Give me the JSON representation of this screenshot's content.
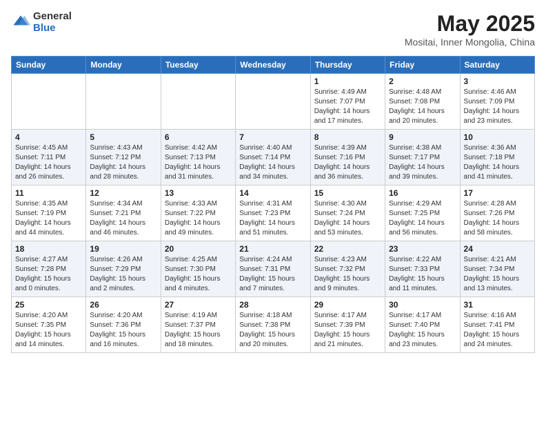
{
  "header": {
    "logo_general": "General",
    "logo_blue": "Blue",
    "month_title": "May 2025",
    "location": "Mositai, Inner Mongolia, China"
  },
  "days_of_week": [
    "Sunday",
    "Monday",
    "Tuesday",
    "Wednesday",
    "Thursday",
    "Friday",
    "Saturday"
  ],
  "weeks": [
    [
      {
        "day": "",
        "info": ""
      },
      {
        "day": "",
        "info": ""
      },
      {
        "day": "",
        "info": ""
      },
      {
        "day": "",
        "info": ""
      },
      {
        "day": "1",
        "info": "Sunrise: 4:49 AM\nSunset: 7:07 PM\nDaylight: 14 hours\nand 17 minutes."
      },
      {
        "day": "2",
        "info": "Sunrise: 4:48 AM\nSunset: 7:08 PM\nDaylight: 14 hours\nand 20 minutes."
      },
      {
        "day": "3",
        "info": "Sunrise: 4:46 AM\nSunset: 7:09 PM\nDaylight: 14 hours\nand 23 minutes."
      }
    ],
    [
      {
        "day": "4",
        "info": "Sunrise: 4:45 AM\nSunset: 7:11 PM\nDaylight: 14 hours\nand 26 minutes."
      },
      {
        "day": "5",
        "info": "Sunrise: 4:43 AM\nSunset: 7:12 PM\nDaylight: 14 hours\nand 28 minutes."
      },
      {
        "day": "6",
        "info": "Sunrise: 4:42 AM\nSunset: 7:13 PM\nDaylight: 14 hours\nand 31 minutes."
      },
      {
        "day": "7",
        "info": "Sunrise: 4:40 AM\nSunset: 7:14 PM\nDaylight: 14 hours\nand 34 minutes."
      },
      {
        "day": "8",
        "info": "Sunrise: 4:39 AM\nSunset: 7:16 PM\nDaylight: 14 hours\nand 36 minutes."
      },
      {
        "day": "9",
        "info": "Sunrise: 4:38 AM\nSunset: 7:17 PM\nDaylight: 14 hours\nand 39 minutes."
      },
      {
        "day": "10",
        "info": "Sunrise: 4:36 AM\nSunset: 7:18 PM\nDaylight: 14 hours\nand 41 minutes."
      }
    ],
    [
      {
        "day": "11",
        "info": "Sunrise: 4:35 AM\nSunset: 7:19 PM\nDaylight: 14 hours\nand 44 minutes."
      },
      {
        "day": "12",
        "info": "Sunrise: 4:34 AM\nSunset: 7:21 PM\nDaylight: 14 hours\nand 46 minutes."
      },
      {
        "day": "13",
        "info": "Sunrise: 4:33 AM\nSunset: 7:22 PM\nDaylight: 14 hours\nand 49 minutes."
      },
      {
        "day": "14",
        "info": "Sunrise: 4:31 AM\nSunset: 7:23 PM\nDaylight: 14 hours\nand 51 minutes."
      },
      {
        "day": "15",
        "info": "Sunrise: 4:30 AM\nSunset: 7:24 PM\nDaylight: 14 hours\nand 53 minutes."
      },
      {
        "day": "16",
        "info": "Sunrise: 4:29 AM\nSunset: 7:25 PM\nDaylight: 14 hours\nand 56 minutes."
      },
      {
        "day": "17",
        "info": "Sunrise: 4:28 AM\nSunset: 7:26 PM\nDaylight: 14 hours\nand 58 minutes."
      }
    ],
    [
      {
        "day": "18",
        "info": "Sunrise: 4:27 AM\nSunset: 7:28 PM\nDaylight: 15 hours\nand 0 minutes."
      },
      {
        "day": "19",
        "info": "Sunrise: 4:26 AM\nSunset: 7:29 PM\nDaylight: 15 hours\nand 2 minutes."
      },
      {
        "day": "20",
        "info": "Sunrise: 4:25 AM\nSunset: 7:30 PM\nDaylight: 15 hours\nand 4 minutes."
      },
      {
        "day": "21",
        "info": "Sunrise: 4:24 AM\nSunset: 7:31 PM\nDaylight: 15 hours\nand 7 minutes."
      },
      {
        "day": "22",
        "info": "Sunrise: 4:23 AM\nSunset: 7:32 PM\nDaylight: 15 hours\nand 9 minutes."
      },
      {
        "day": "23",
        "info": "Sunrise: 4:22 AM\nSunset: 7:33 PM\nDaylight: 15 hours\nand 11 minutes."
      },
      {
        "day": "24",
        "info": "Sunrise: 4:21 AM\nSunset: 7:34 PM\nDaylight: 15 hours\nand 13 minutes."
      }
    ],
    [
      {
        "day": "25",
        "info": "Sunrise: 4:20 AM\nSunset: 7:35 PM\nDaylight: 15 hours\nand 14 minutes."
      },
      {
        "day": "26",
        "info": "Sunrise: 4:20 AM\nSunset: 7:36 PM\nDaylight: 15 hours\nand 16 minutes."
      },
      {
        "day": "27",
        "info": "Sunrise: 4:19 AM\nSunset: 7:37 PM\nDaylight: 15 hours\nand 18 minutes."
      },
      {
        "day": "28",
        "info": "Sunrise: 4:18 AM\nSunset: 7:38 PM\nDaylight: 15 hours\nand 20 minutes."
      },
      {
        "day": "29",
        "info": "Sunrise: 4:17 AM\nSunset: 7:39 PM\nDaylight: 15 hours\nand 21 minutes."
      },
      {
        "day": "30",
        "info": "Sunrise: 4:17 AM\nSunset: 7:40 PM\nDaylight: 15 hours\nand 23 minutes."
      },
      {
        "day": "31",
        "info": "Sunrise: 4:16 AM\nSunset: 7:41 PM\nDaylight: 15 hours\nand 24 minutes."
      }
    ]
  ]
}
